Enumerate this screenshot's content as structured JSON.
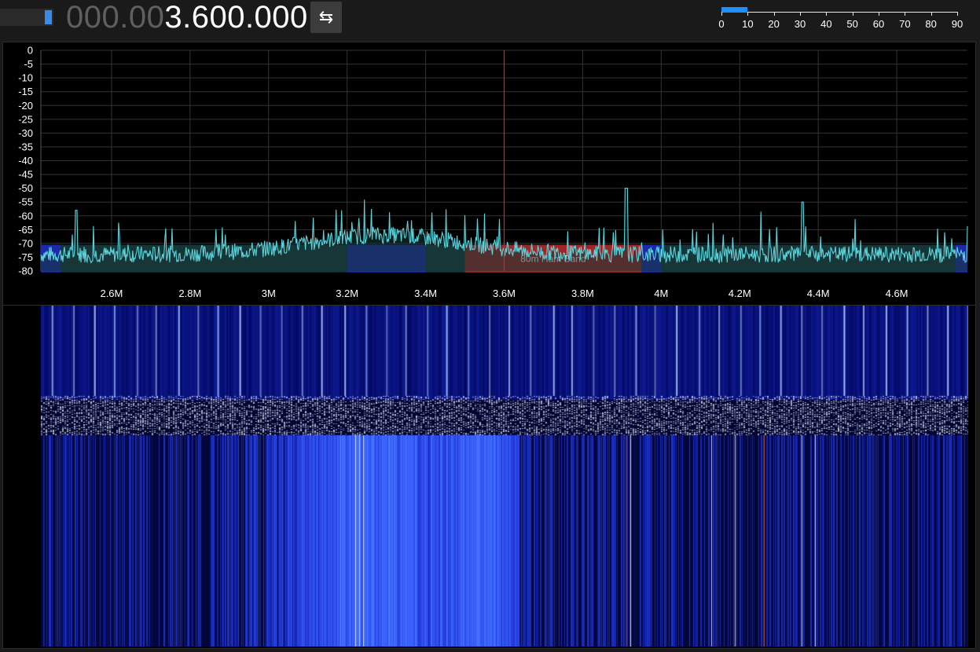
{
  "header": {
    "frequency_lead": "000.00",
    "frequency_main": "3.600.000",
    "swap_icon": "⇆",
    "signal_level": 0.85
  },
  "zoom": {
    "labels": [
      "0",
      "10",
      "20",
      "30",
      "40",
      "50",
      "60",
      "70",
      "80",
      "90"
    ],
    "value": 10,
    "max": 90
  },
  "spectrum": {
    "y_ticks": [
      "0",
      "-5",
      "-10",
      "-15",
      "-20",
      "-25",
      "-30",
      "-35",
      "-40",
      "-45",
      "-50",
      "-55",
      "-60",
      "-65",
      "-70",
      "-75",
      "-80"
    ],
    "x_ticks": [
      "2.6M",
      "2.8M",
      "3M",
      "3.2M",
      "3.4M",
      "3.6M",
      "3.8M",
      "4M",
      "4.2M",
      "4.4M",
      "4.6M"
    ],
    "x_range_mhz": [
      2.42,
      4.78
    ],
    "y_range_db": [
      -80,
      0
    ],
    "center_mhz": 3.6,
    "bands": [
      {
        "label": "80m Ham Band",
        "start_mhz": 3.5,
        "end_mhz": 3.95,
        "color": "#b52525"
      }
    ],
    "colors": {
      "trace": "#5ad4dc",
      "trace_fill": "#173638",
      "center_line": "#e02020",
      "band_blue": "#1a2aa8"
    }
  }
}
